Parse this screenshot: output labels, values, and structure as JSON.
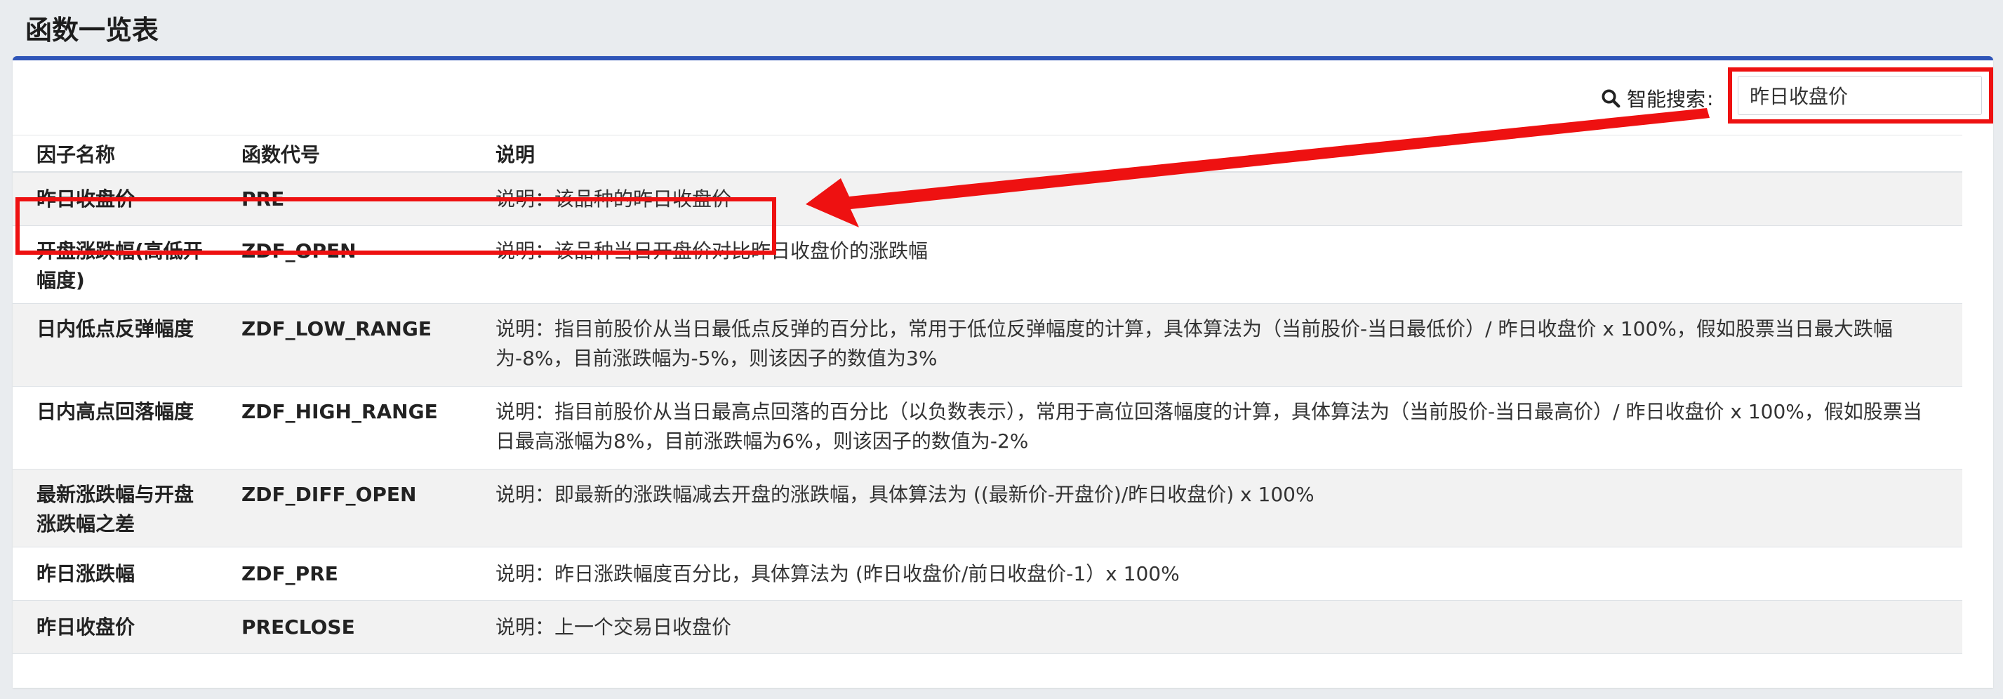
{
  "page": {
    "title": "函数一览表"
  },
  "search": {
    "label": "智能搜索",
    "colon": ":",
    "value": "昨日收盘价",
    "icon": "search-icon"
  },
  "table": {
    "headers": [
      "因子名称",
      "函数代号",
      "说明"
    ],
    "rows": [
      {
        "name": "昨日收盘价",
        "code": "PRE",
        "desc": "说明：该品种的昨日收盘价"
      },
      {
        "name": "开盘涨跌幅(高低开幅度)",
        "code": "ZDF_OPEN",
        "desc": "说明：该品种当日开盘价对比昨日收盘价的涨跌幅"
      },
      {
        "name": "日内低点反弹幅度",
        "code": "ZDF_LOW_RANGE",
        "desc": "说明：指目前股价从当日最低点反弹的百分比，常用于低位反弹幅度的计算，具体算法为（当前股价-当日最低价）/ 昨日收盘价 x 100%，假如股票当日最大跌幅为-8%，目前涨跌幅为-5%，则该因子的数值为3%"
      },
      {
        "name": "日内高点回落幅度",
        "code": "ZDF_HIGH_RANGE",
        "desc": "说明：指目前股价从当日最高点回落的百分比（以负数表示），常用于高位回落幅度的计算，具体算法为（当前股价-当日最高价）/ 昨日收盘价 x 100%，假如股票当日最高涨幅为8%，目前涨跌幅为6%，则该因子的数值为-2%"
      },
      {
        "name": "最新涨跌幅与开盘涨跌幅之差",
        "code": "ZDF_DIFF_OPEN",
        "desc": "说明：即最新的涨跌幅减去开盘的涨跌幅，具体算法为 ((最新价-开盘价)/昨日收盘价) x 100%"
      },
      {
        "name": "昨日涨跌幅",
        "code": "ZDF_PRE",
        "desc": "说明：昨日涨跌幅度百分比，具体算法为 (昨日收盘价/前日收盘价-1）x 100%"
      },
      {
        "name": "昨日收盘价",
        "code": "PRECLOSE",
        "desc": "说明：上一个交易日收盘价"
      }
    ]
  },
  "annotations": {
    "highlight_color": "#ee1111"
  },
  "colors": {
    "accent": "#2f55b8",
    "alt_row": "#f2f2f2",
    "annotation": "#ee1111"
  }
}
